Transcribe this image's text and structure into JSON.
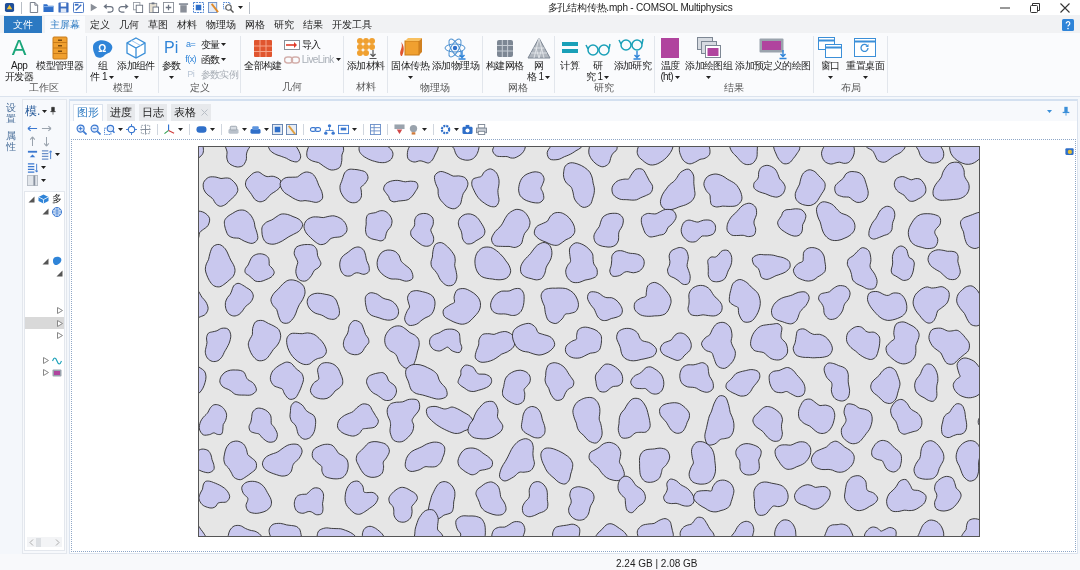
{
  "window": {
    "title": "多孔结构传热.mph - COMSOL Multiphysics"
  },
  "ribbon_tabs": [
    {
      "label": "文件",
      "kind": "file",
      "selected": false
    },
    {
      "label": "主屏幕",
      "kind": "tab",
      "selected": true
    },
    {
      "label": "定义",
      "kind": "tab",
      "selected": false
    },
    {
      "label": "几何",
      "kind": "tab",
      "selected": false
    },
    {
      "label": "草图",
      "kind": "tab",
      "selected": false
    },
    {
      "label": "材料",
      "kind": "tab",
      "selected": false
    },
    {
      "label": "物理场",
      "kind": "tab",
      "selected": false
    },
    {
      "label": "网格",
      "kind": "tab",
      "selected": false
    },
    {
      "label": "研究",
      "kind": "tab",
      "selected": false
    },
    {
      "label": "结果",
      "kind": "tab",
      "selected": false
    },
    {
      "label": "开发工具",
      "kind": "tab",
      "selected": false
    }
  ],
  "ribbon_groups": [
    {
      "label": "工作区",
      "buttons": [
        {
          "kind": "large",
          "glyph": "A",
          "lines": [
            "App",
            "开发器"
          ],
          "disabled": false
        },
        {
          "kind": "large",
          "lines": [
            "模型管理器"
          ],
          "disabled": false
        }
      ]
    },
    {
      "label": "模型",
      "buttons": [
        {
          "kind": "large",
          "glyph": "Ω",
          "lines": [
            "组",
            "件 1"
          ],
          "dropdown": true,
          "disabled": false
        },
        {
          "kind": "large",
          "lines": [
            "添加组件"
          ],
          "dropdown": true,
          "disabled": false
        }
      ]
    },
    {
      "label": "定义",
      "buttons": [
        {
          "kind": "large",
          "glyph": "Pi",
          "lines": [
            "参数"
          ],
          "dropdown": true,
          "disabled": false
        },
        {
          "kind": "small",
          "glyph": "a=",
          "lines": [
            "变量"
          ],
          "dropdown": true,
          "disabled": false
        },
        {
          "kind": "small",
          "glyph": "f(x)",
          "lines": [
            "函数"
          ],
          "dropdown": true,
          "disabled": false
        },
        {
          "kind": "small",
          "glyph": "Pi",
          "lines": [
            "参数实例"
          ],
          "disabled": true
        }
      ]
    },
    {
      "label": "几何",
      "buttons": [
        {
          "kind": "large",
          "lines": [
            "全部构建"
          ],
          "disabled": false
        },
        {
          "kind": "small",
          "lines": [
            "导入"
          ],
          "disabled": false
        },
        {
          "kind": "small",
          "lines": [
            "LiveLink"
          ],
          "dropdown": true,
          "disabled": true
        }
      ]
    },
    {
      "label": "材料",
      "buttons": [
        {
          "kind": "large",
          "lines": [
            "添加材料"
          ],
          "disabled": false
        }
      ]
    },
    {
      "label": "物理场",
      "buttons": [
        {
          "kind": "large",
          "lines": [
            "固体传热"
          ],
          "dropdown": true,
          "disabled": false
        },
        {
          "kind": "large",
          "lines": [
            "添加物理场"
          ],
          "disabled": false
        }
      ]
    },
    {
      "label": "网格",
      "buttons": [
        {
          "kind": "large",
          "lines": [
            "构建网格"
          ],
          "disabled": false
        },
        {
          "kind": "large",
          "lines": [
            "网",
            "格 1"
          ],
          "dropdown": true,
          "disabled": false
        }
      ]
    },
    {
      "label": "研究",
      "buttons": [
        {
          "kind": "large",
          "lines": [
            "计算"
          ],
          "disabled": false
        },
        {
          "kind": "large",
          "lines": [
            "研",
            "究 1"
          ],
          "dropdown": true,
          "disabled": false
        },
        {
          "kind": "large",
          "lines": [
            "添加研究"
          ],
          "disabled": false
        }
      ]
    },
    {
      "label": "结果",
      "buttons": [
        {
          "kind": "large",
          "lines": [
            "温度",
            "(ht)"
          ],
          "dropdown": true,
          "disabled": false
        },
        {
          "kind": "large",
          "lines": [
            "添加绘图组"
          ],
          "dropdown": true,
          "disabled": false
        },
        {
          "kind": "large",
          "lines": [
            "添加预定义的绘图"
          ],
          "disabled": false
        }
      ]
    },
    {
      "label": "布局",
      "buttons": [
        {
          "kind": "large",
          "lines": [
            "窗口"
          ],
          "dropdown": true,
          "disabled": false
        },
        {
          "kind": "large",
          "lines": [
            "重置桌面"
          ],
          "dropdown": true,
          "disabled": false
        }
      ]
    }
  ],
  "side_tabs": [
    {
      "label": "设置"
    },
    {
      "label": "属性"
    }
  ],
  "model_builder": {
    "title": "模.",
    "tree": [
      {
        "kind": "model",
        "label": "多",
        "expanded": true,
        "selected": false,
        "children": [
          {
            "kind": "globe",
            "expanded": true,
            "selected": false,
            "children": [
              {
                "selected": false
              },
              {
                "selected": false
              },
              {
                "selected": false
              }
            ]
          },
          {
            "kind": "component",
            "expanded": true,
            "selected": false,
            "children": [
              {
                "expanded": true,
                "selected": false,
                "children": [
                  {
                    "selected": false
                  },
                  {
                    "selected": false
                  }
                ]
              },
              {
                "expanded": false,
                "selected": false
              },
              {
                "expanded": false,
                "selected": true
              },
              {
                "expanded": false,
                "selected": false
              },
              {
                "selected": false
              }
            ]
          },
          {
            "kind": "study",
            "expanded": false,
            "selected": false
          },
          {
            "kind": "results",
            "expanded": false,
            "selected": false
          }
        ]
      }
    ]
  },
  "graphics": {
    "tabs": [
      {
        "label": "图形",
        "selected": true,
        "closable": false
      },
      {
        "label": "进度",
        "selected": false,
        "closable": false
      },
      {
        "label": "日志",
        "selected": false,
        "closable": false
      },
      {
        "label": "表格",
        "selected": false,
        "closable": true
      }
    ]
  },
  "status_bar": {
    "memory": "2.24 GB | 2.08 GB"
  }
}
